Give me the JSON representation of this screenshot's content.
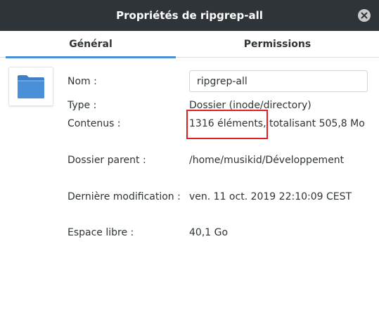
{
  "window": {
    "title": "Propriétés de ripgrep-all"
  },
  "tabs": [
    {
      "label": "Général",
      "active": true
    },
    {
      "label": "Permissions",
      "active": false
    }
  ],
  "folder_icon": {
    "name": "folder-icon",
    "color": "#4a90d9"
  },
  "properties": {
    "name_label": "Nom :",
    "name_value": "ripgrep-all",
    "type_label": "Type :",
    "type_value": "Dossier (inode/directory)",
    "contents_label": "Contenus :",
    "contents_value": "1316 éléments, totalisant 505,8 Mo",
    "parent_label": "Dossier parent :",
    "parent_value": "/home/musikid/Développement",
    "modified_label": "Dernière modification :",
    "modified_value": "ven. 11 oct. 2019 22:10:09 CEST",
    "free_label": "Espace libre :",
    "free_value": "40,1 Go"
  },
  "colors": {
    "titlebar": "#2f3439",
    "accent": "#4a90d9",
    "annotation": "#e02020"
  }
}
